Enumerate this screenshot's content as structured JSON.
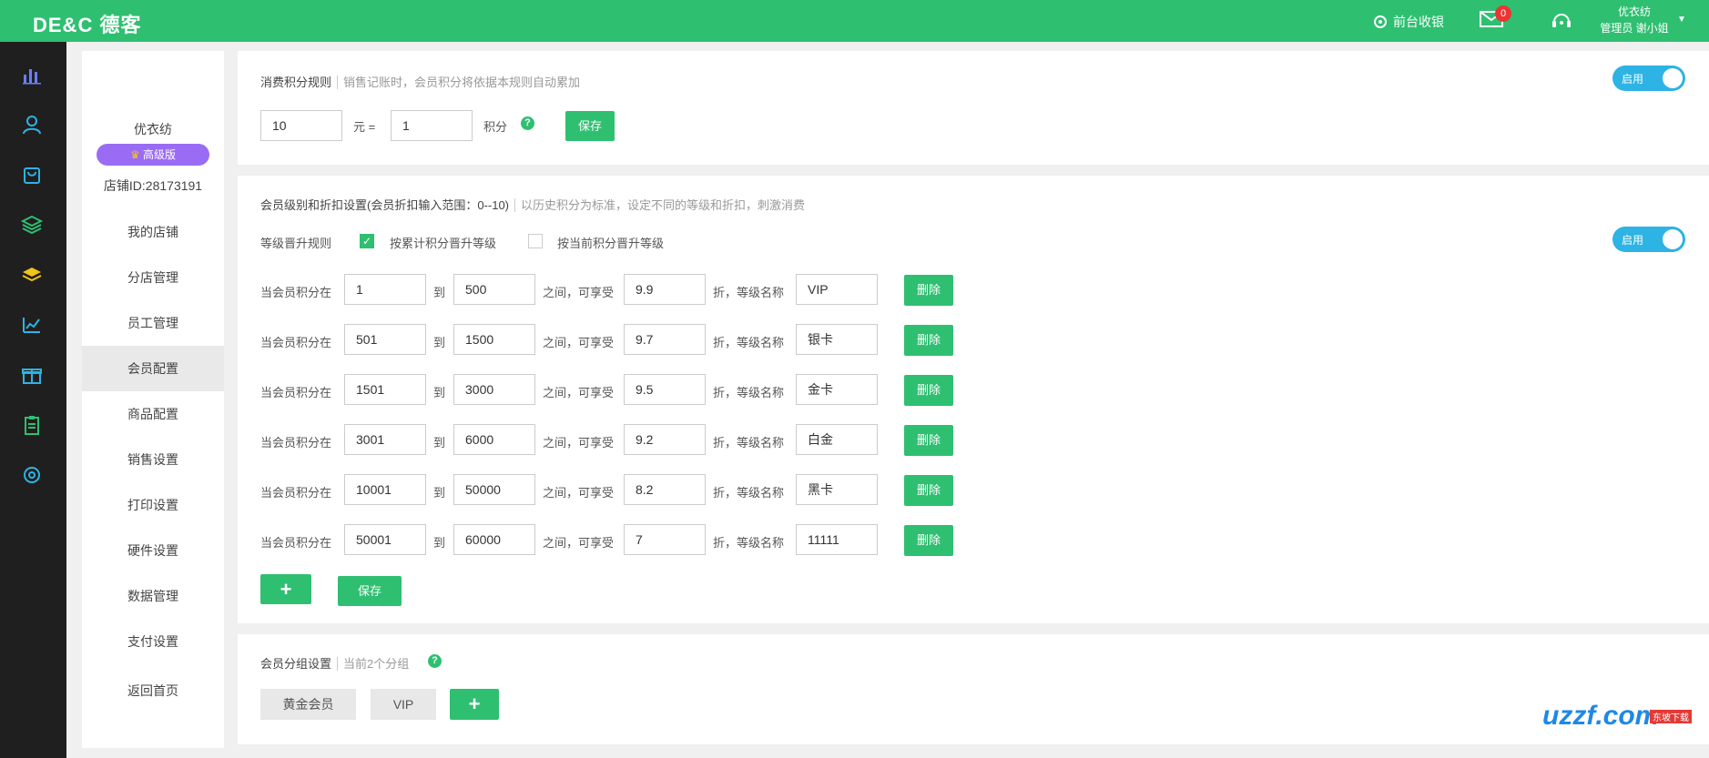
{
  "header": {
    "logo": "DE&C 德客",
    "front_cashier": "前台收银",
    "mail_badge": "0",
    "user_shop": "优衣纺",
    "user_role": "管理员 谢小姐"
  },
  "subnav": {
    "shop_name": "优衣纺",
    "level": "高级版",
    "shop_id": "店铺ID:28173191",
    "items": [
      "我的店铺",
      "分店管理",
      "员工管理",
      "会员配置",
      "商品配置",
      "销售设置",
      "打印设置",
      "硬件设置",
      "数据管理",
      "支付设置",
      "返回首页"
    ],
    "active": "会员配置"
  },
  "points_rule": {
    "title": "消费积分规则",
    "hint": "销售记账时，会员积分将依据本规则自动累加",
    "amount": "10",
    "equals_label": "元 =",
    "points": "1",
    "points_label": "积分",
    "save": "保存",
    "toggle": "启用"
  },
  "levels": {
    "title": "会员级别和折扣设置(会员折扣输入范围：0--10)",
    "hint": "以历史积分为标准，设定不同的等级和折扣，刺激消费",
    "upgrade_label": "等级晋升规则",
    "opt_cumulative": "按累计积分晋升等级",
    "opt_current": "按当前积分晋升等级",
    "toggle": "启用",
    "row_prefix": "当会员积分在",
    "row_to": "到",
    "row_between": "之间，可享受",
    "row_discount": "折，等级名称",
    "delete": "删除",
    "rows": [
      {
        "from": "1",
        "to": "500",
        "discount": "9.9",
        "name": "VIP"
      },
      {
        "from": "501",
        "to": "1500",
        "discount": "9.7",
        "name": "银卡"
      },
      {
        "from": "1501",
        "to": "3000",
        "discount": "9.5",
        "name": "金卡"
      },
      {
        "from": "3001",
        "to": "6000",
        "discount": "9.2",
        "name": "白金"
      },
      {
        "from": "10001",
        "to": "50000",
        "discount": "8.2",
        "name": "黑卡"
      },
      {
        "from": "50001",
        "to": "60000",
        "discount": "7",
        "name": "11111"
      }
    ],
    "add": "+",
    "save": "保存"
  },
  "groups": {
    "title": "会员分组设置",
    "hint": "当前2个分组",
    "items": [
      "黄金会员",
      "VIP"
    ],
    "add": "+"
  },
  "watermark": {
    "text": "uzzf.com",
    "badge": "东坡下载"
  },
  "colors": {
    "brand": "#2fbf71",
    "toggle": "#2db3e4",
    "pill": "#9a6cf4",
    "sidebar": "#1f1f1f"
  }
}
